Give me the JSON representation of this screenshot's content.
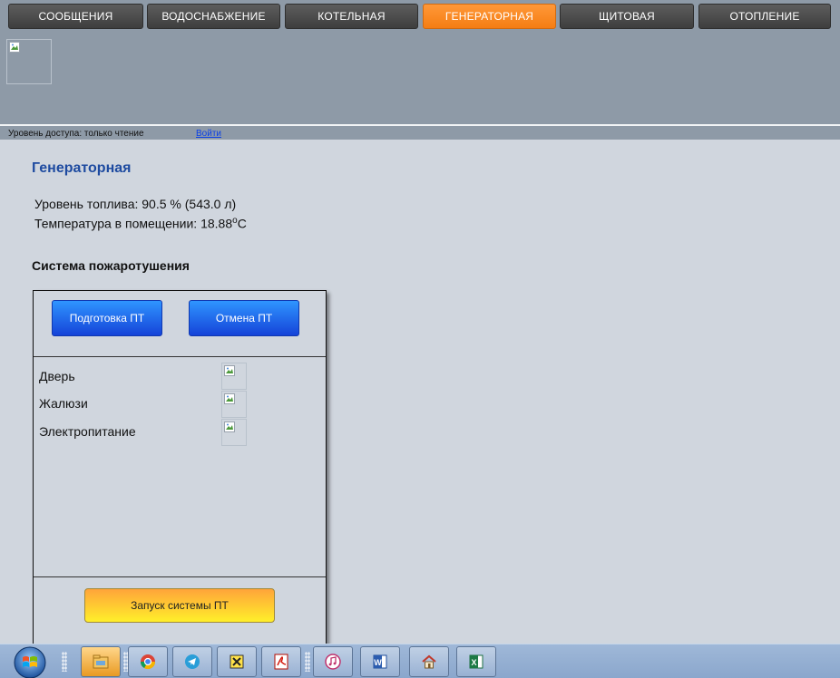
{
  "nav": {
    "tabs": [
      {
        "label": "СООБЩЕНИЯ",
        "active": false
      },
      {
        "label": "ВОДОСНАБЖЕНИЕ",
        "active": false
      },
      {
        "label": "КОТЕЛЬНАЯ",
        "active": false
      },
      {
        "label": "ГЕНЕРАТОРНАЯ",
        "active": true
      },
      {
        "label": "ЩИТОВАЯ",
        "active": false
      },
      {
        "label": "ОТОПЛЕНИЕ",
        "active": false
      }
    ]
  },
  "access": {
    "text": "Уровень доступа: только чтение",
    "login_link": "Войти"
  },
  "page": {
    "title": "Генераторная",
    "fuel_label": "Уровень топлива: 90.5 % (543.0 л)",
    "temp_label": "Температура в помещении: 18.88",
    "temp_unit_sup": "o",
    "temp_unit": "C"
  },
  "fire_system": {
    "title": "Система пожаротушения",
    "prepare_button": "Подготовка ПТ",
    "cancel_button": "Отмена ПТ",
    "statuses": [
      {
        "label": "Дверь"
      },
      {
        "label": "Жалюзи"
      },
      {
        "label": "Электропитание"
      }
    ],
    "launch_button": "Запуск системы ПТ"
  },
  "taskbar": {
    "apps": [
      {
        "icon": "file-explorer-icon"
      },
      {
        "icon": "chrome-icon"
      },
      {
        "icon": "telegram-icon"
      },
      {
        "icon": "app-puzzle-icon"
      },
      {
        "icon": "pdf-reader-icon"
      },
      {
        "icon": "itunes-icon"
      },
      {
        "icon": "word-icon"
      },
      {
        "icon": "home-icon"
      },
      {
        "icon": "excel-icon"
      }
    ]
  },
  "colors": {
    "active_tab": "#f98a24",
    "title_blue": "#1e4ba0",
    "button_blue": "#1f62ea",
    "launch_orange": "#ffbe2e"
  }
}
